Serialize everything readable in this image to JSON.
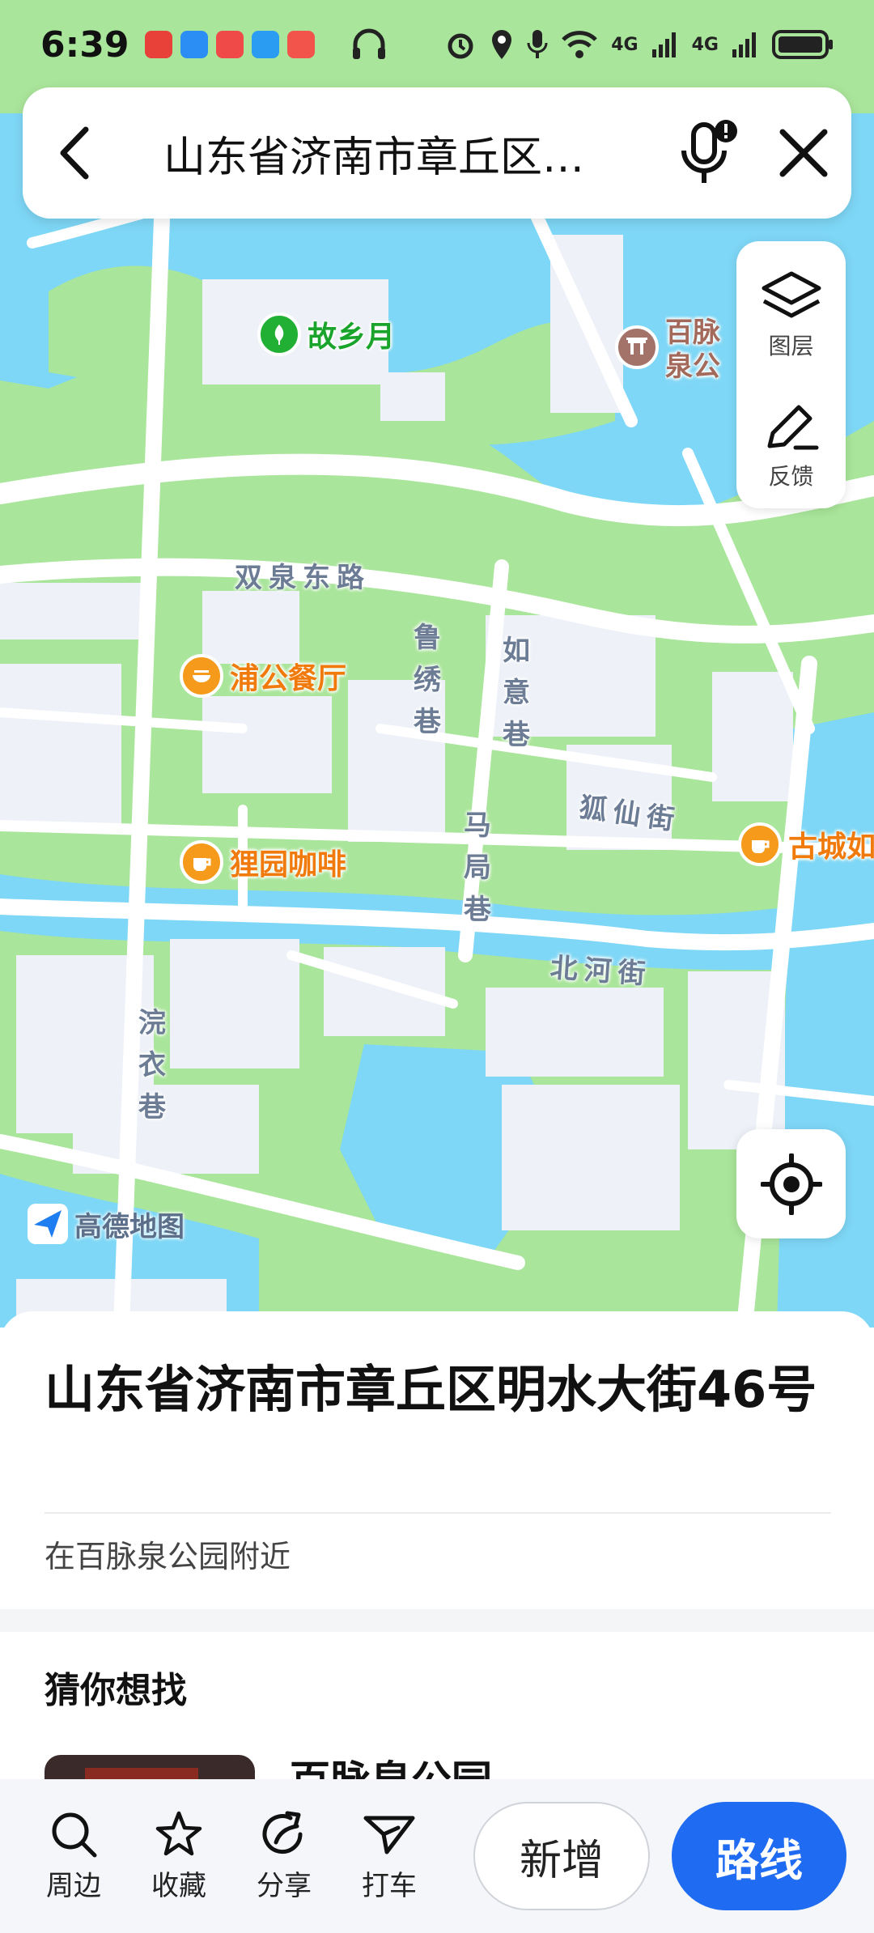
{
  "status_bar": {
    "time": "6:39",
    "network_1": "4G",
    "network_2": "4G"
  },
  "search": {
    "query": "山东省济南市章丘区…"
  },
  "map_tools": {
    "layers_label": "图层",
    "feedback_label": "反馈"
  },
  "map": {
    "pois": [
      {
        "name": "故乡月",
        "category": "park"
      },
      {
        "name": "百脉泉公园景区-玉",
        "category": "scenic"
      },
      {
        "name": "浦公餐厅",
        "category": "restaurant"
      },
      {
        "name": "狸园咖啡",
        "category": "cafe"
      },
      {
        "name": "古城如",
        "category": "cafe"
      }
    ],
    "streets": {
      "shuangquan": "双泉东路",
      "luxiu": "鲁绣巷",
      "ruyi": "如意巷",
      "huxian": "狐仙街",
      "maju": "马局巷",
      "beihe": "北河街",
      "huanyi": "浣衣巷"
    },
    "brand": "高德地图"
  },
  "place": {
    "address": "山东省济南市章丘区明水大街46号",
    "nearby": "在百脉泉公园附近"
  },
  "suggestions": {
    "heading": "猜你想找",
    "first_item": "百脉泉公园"
  },
  "actions": {
    "nearby": "周边",
    "favorite": "收藏",
    "share": "分享",
    "taxi": "打车",
    "add": "新增",
    "route": "路线"
  },
  "colors": {
    "park_green": "#a9e59a",
    "water_blue": "#7ed7f6",
    "route_blue": "#1f6bf2",
    "poi_orange": "#f59a1b",
    "poi_green": "#21b033"
  }
}
